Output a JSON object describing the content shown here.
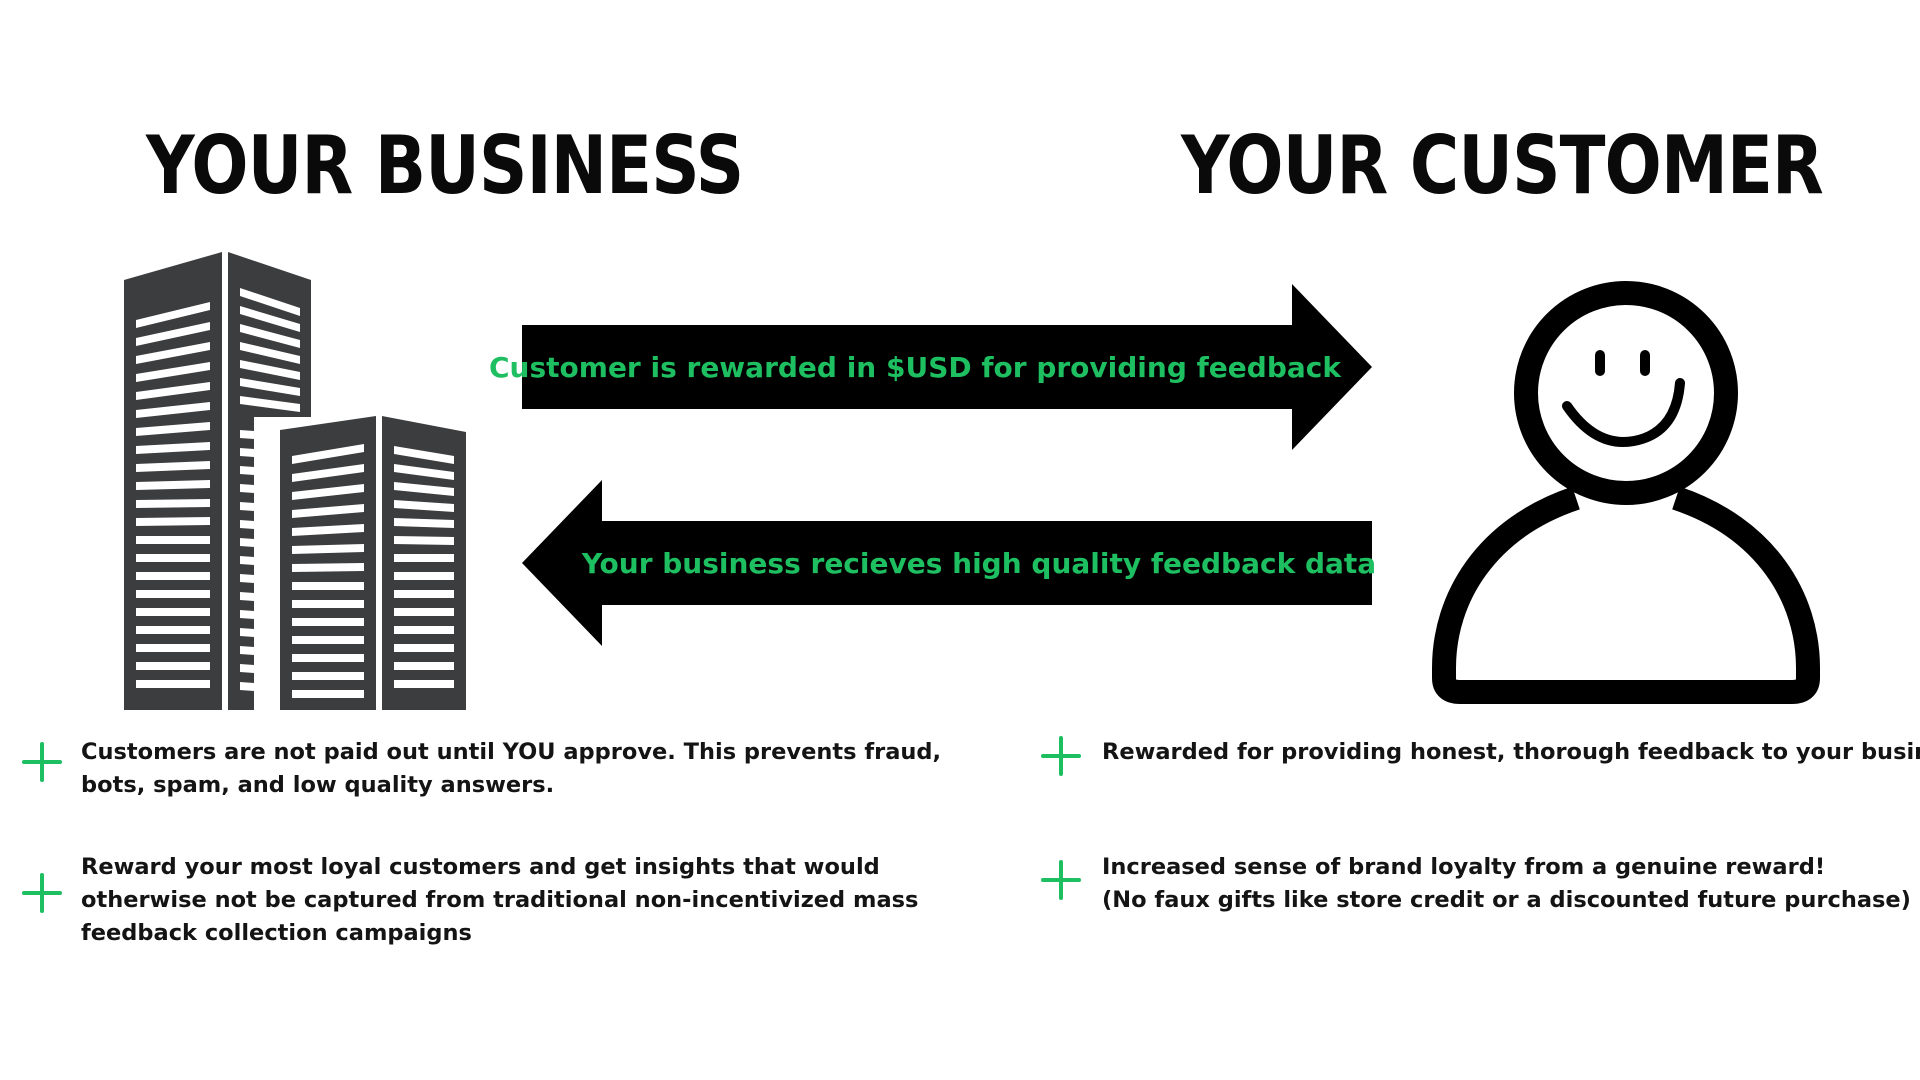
{
  "headings": {
    "business": "YOUR BUSINESS",
    "customer": "YOUR CUSTOMER"
  },
  "arrows": {
    "to_customer": "Customer is rewarded in $USD for providing feedback",
    "to_business": "Your business recieves high quality feedback data"
  },
  "business_points": [
    "Customers are not paid out until YOU approve. This prevents fraud, bots, spam, and low quality answers.",
    "Reward your most loyal customers and get insights that would otherwise not be captured from traditional non-incentivized mass feedback collection campaigns"
  ],
  "customer_points": [
    "Rewarded for providing honest, thorough feedback to your business",
    "Increased sense of brand loyalty from a genuine reward!",
    "(No faux gifts like store credit or a discounted future purchase)"
  ],
  "icons": {
    "business": "office-buildings-icon",
    "customer": "smiling-person-icon",
    "bullet": "plus-icon"
  },
  "colors": {
    "accent_green": "#1dbf61",
    "arrow_fill": "#000000",
    "building_fill": "#3c3d3f"
  }
}
